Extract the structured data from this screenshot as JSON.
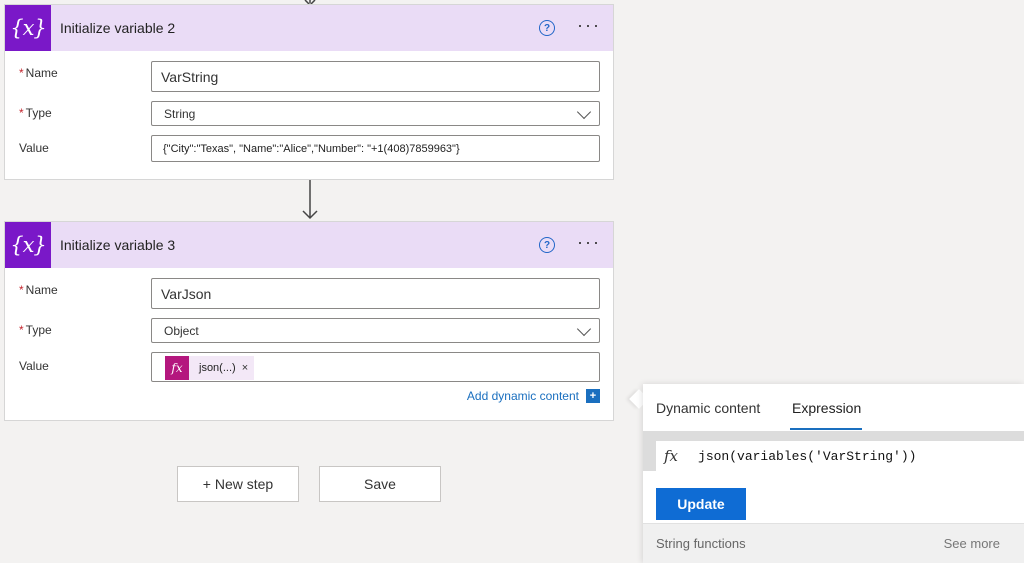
{
  "cards": [
    {
      "icon": "{x}",
      "title": "Initialize variable 2",
      "help": "?",
      "more": "···",
      "name_label": "Name",
      "name_value": "VarString",
      "type_label": "Type",
      "type_value": "String",
      "value_label": "Value",
      "value_text": "{\"City\":\"Texas\", \"Name\":\"Alice\",\"Number\": \"+1(408)7859963\"}"
    },
    {
      "icon": "{x}",
      "title": "Initialize variable 3",
      "help": "?",
      "more": "···",
      "name_label": "Name",
      "name_value": "VarJson",
      "type_label": "Type",
      "type_value": "Object",
      "value_label": "Value",
      "chip_icon": "fx",
      "chip_text": "json(...)",
      "chip_close": "×",
      "add_dynamic": "Add dynamic content",
      "add_dynamic_icon": "+"
    }
  ],
  "required_mark": "*",
  "buttons": {
    "new_step": "+ New step",
    "save": "Save"
  },
  "panel": {
    "tabs": [
      "Dynamic content",
      "Expression"
    ],
    "active_tab": "Expression",
    "fx": "fx",
    "expression": "json(variables('VarString'))",
    "update": "Update",
    "footer_left": "String functions",
    "footer_right": "See more"
  },
  "colors": {
    "header_bg": "#eadcf6",
    "icon_bg": "#7a18c8",
    "chip_fx_bg": "#b4177e",
    "accent": "#0f6cd4"
  }
}
